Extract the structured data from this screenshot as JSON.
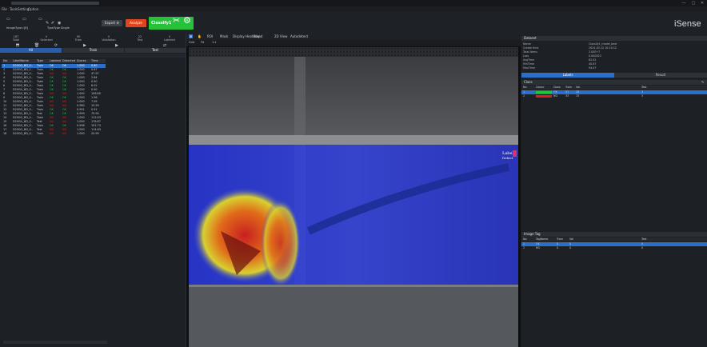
{
  "window": {
    "title_redacted": true,
    "controls": [
      "—",
      "□",
      "✕"
    ]
  },
  "menu": [
    "File",
    "Tools",
    "Setting",
    "Option"
  ],
  "toolbar": {
    "image_types_label": "ImageType=[8]",
    "filters": [
      "TypeType",
      "Single"
    ],
    "export_label": "Export ⚙",
    "analyze_label": "Analyze",
    "classify_label": "Classify1",
    "logo": "iSense"
  },
  "left": {
    "stats": [
      [
        "167",
        "Total"
      ],
      [
        "0",
        "Selected"
      ],
      [
        "90",
        "Train"
      ],
      [
        "0",
        "Validation"
      ],
      [
        "22",
        "Test"
      ],
      [
        "0",
        "Labeled"
      ]
    ],
    "tabs": [
      "All",
      "Train",
      "Test"
    ],
    "columns": [
      "No.",
      "LabelName",
      "Type",
      "Labeled",
      "Detected",
      "Scores",
      "Time"
    ],
    "rows": [
      [
        "1",
        "D20GG_BD_0..",
        "Train",
        "OK",
        "OK",
        "1.000",
        "0.80"
      ],
      [
        "2",
        "D20GG_BD_1..",
        "Train",
        "OK",
        "OK",
        "1.000",
        "0.87"
      ],
      [
        "3",
        "D20GG_BD_0..",
        "Train",
        "NG",
        "NG",
        "1.000",
        "47.97"
      ],
      [
        "4",
        "D20GG_BD_0..",
        "Train",
        "OK",
        "OK",
        "1.000",
        "2.64"
      ],
      [
        "5",
        "D20GG_BD_0..",
        "Train",
        "OK",
        "OK",
        "1.000",
        "0.90"
      ],
      [
        "6",
        "D20GG_BD_0..",
        "Train",
        "OK",
        "OK",
        "1.000",
        "6.02"
      ],
      [
        "7",
        "D20GG_BD_0..",
        "Train",
        "OK",
        "OK",
        "1.000",
        "0.90"
      ],
      [
        "8",
        "D20GG_BD_0..",
        "Train",
        "NG",
        "NG",
        "1.000",
        "106.60"
      ],
      [
        "9",
        "D20GG_BD_0..",
        "Train",
        "OK",
        "OK",
        "1.000",
        "1.96"
      ],
      [
        "10",
        "D20GG_BD_0..",
        "Train",
        "NG",
        "NG",
        "1.000",
        "7.09"
      ],
      [
        "11",
        "D20GG_BD_0..",
        "Train",
        "NG",
        "NG",
        "0.980",
        "15.59"
      ],
      [
        "12",
        "D20GG_BD_0..",
        "Train",
        "OK",
        "OK",
        "0.991",
        "0.91"
      ],
      [
        "13",
        "D20GG_BD_0..",
        "Test",
        "OK",
        "OK",
        "0.999",
        "79.94"
      ],
      [
        "14",
        "D20GG_BD_0..",
        "Train",
        "NG",
        "NG",
        "1.000",
        "112.43"
      ],
      [
        "15",
        "D20GG_BD_0..",
        "Test",
        "NG",
        "NG",
        "1.000",
        "178.67"
      ],
      [
        "16",
        "D20GG_BD_0..",
        "Train",
        "OK",
        "OK",
        "0.998",
        "101.73"
      ],
      [
        "17",
        "D20GG_BD_0..",
        "Test",
        "NG",
        "NG",
        "1.000",
        "114.63"
      ],
      [
        "18",
        "D20GG_BD_0..",
        "Train",
        "NG",
        "NG",
        "1.000",
        "20.99"
      ]
    ]
  },
  "center": {
    "tools": [
      "⊞",
      "✋",
      "ROI",
      "Mask",
      "Display Heatmap",
      "Blend",
      "2D View",
      "Autodetect"
    ],
    "sub": [
      "Grid",
      "Fit",
      "1:1"
    ],
    "overlay": "Label1\nDetect"
  },
  "right": {
    "dataset_title": "Dataset",
    "kv": [
      [
        "Name",
        "Classify1_model_best"
      ],
      [
        "Create time",
        "2024-03-12 10:10:12"
      ],
      [
        "Total Items",
        "2.05E+7"
      ],
      [
        "Loss",
        "0.000023"
      ],
      [
        "AvgTime",
        "62.02"
      ],
      [
        "MinTime",
        "40.67"
      ],
      [
        "MaxTime",
        "94.07"
      ]
    ],
    "tabs": [
      "Labels",
      "Result"
    ],
    "class_title": "Class",
    "class_cols": [
      "No",
      "Colour",
      "Class",
      "Train",
      "Val",
      "Test"
    ],
    "classes": [
      [
        "1",
        "OK",
        "57",
        "28",
        "3",
        "14"
      ],
      [
        "2",
        "NG",
        "33",
        "15",
        "3",
        "16"
      ]
    ],
    "tag_title": "Image Tag",
    "tag_cols": [
      "No",
      "TagName",
      "Train",
      "Val",
      "Test"
    ],
    "tags": [
      [
        "1",
        "OK",
        "0",
        "0",
        "0"
      ],
      [
        "2",
        "NG",
        "0",
        "0",
        "0"
      ]
    ],
    "colors": {
      "ok": "#1ec83a",
      "ng": "#e01c1c",
      "selected": "#2a6fc9"
    }
  }
}
